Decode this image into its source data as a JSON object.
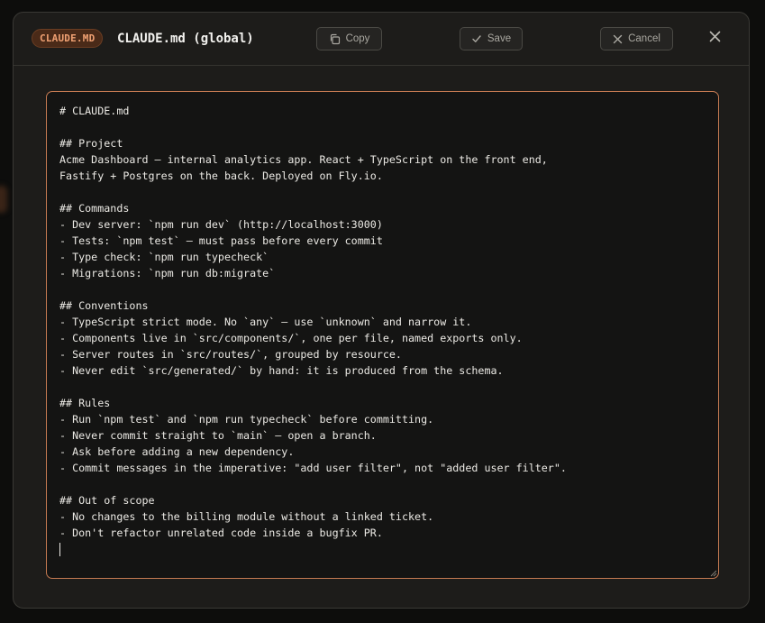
{
  "modal": {
    "badge": "CLAUDE.MD",
    "title": "CLAUDE.md (global)",
    "copy_label": "Copy",
    "save_label": "Save",
    "cancel_label": "Cancel",
    "icons": {
      "copy": "copy-icon",
      "save": "check-icon",
      "cancel": "x-icon",
      "close": "close-icon"
    }
  },
  "editor": {
    "content": "# CLAUDE.md\n\n## Project\nAcme Dashboard — internal analytics app. React + TypeScript on the front end,\nFastify + Postgres on the back. Deployed on Fly.io.\n\n## Commands\n- Dev server: `npm run dev` (http://localhost:3000)\n- Tests: `npm test` — must pass before every commit\n- Type check: `npm run typecheck`\n- Migrations: `npm run db:migrate`\n\n## Conventions\n- TypeScript strict mode. No `any` — use `unknown` and narrow it.\n- Components live in `src/components/`, one per file, named exports only.\n- Server routes in `src/routes/`, grouped by resource.\n- Never edit `src/generated/` by hand: it is produced from the schema.\n\n## Rules\n- Run `npm test` and `npm run typecheck` before committing.\n- Never commit straight to `main` — open a branch.\n- Ask before adding a new dependency.\n- Commit messages in the imperative: \"add user filter\", not \"added user filter\".\n\n## Out of scope\n- No changes to the billing module without a linked ticket.\n- Don't refactor unrelated code inside a bugfix PR.\n"
  },
  "colors": {
    "accent": "#c57a52",
    "badge_bg": "#4a2a18",
    "badge_text": "#f0a173",
    "modal_bg": "#1d1c1a",
    "editor_bg": "#141413"
  }
}
